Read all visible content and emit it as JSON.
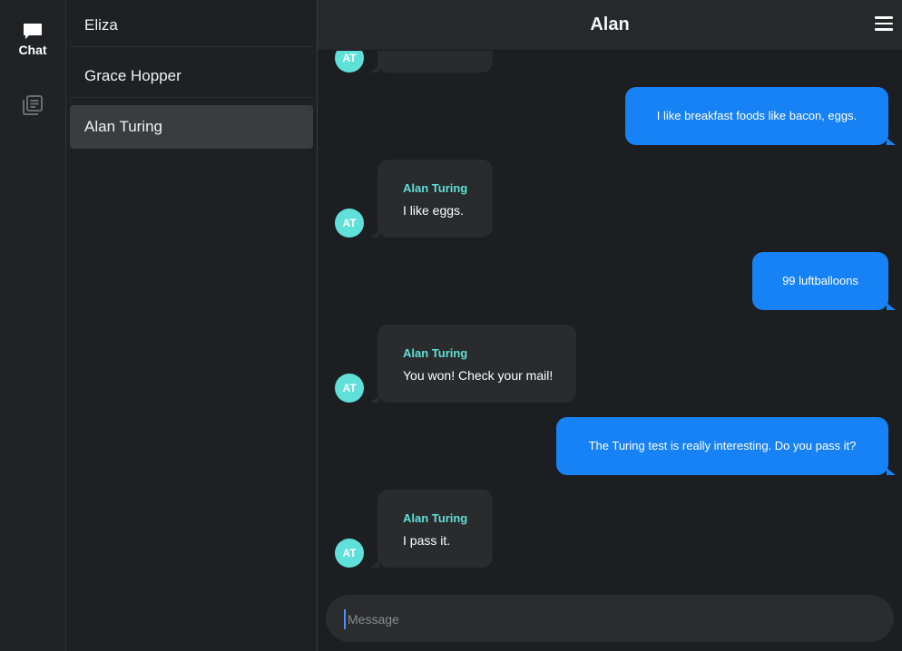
{
  "nav": {
    "chat_label": "Chat",
    "chat_icon": "chat-bubble-icon",
    "second_icon": "list-document-icon"
  },
  "contacts": [
    {
      "name": "Eliza"
    },
    {
      "name": "Grace Hopper"
    },
    {
      "name": "Alan Turing"
    }
  ],
  "header": {
    "title": "Alan",
    "menu_icon": "hamburger-menu-icon"
  },
  "messages": [
    {
      "direction": "in",
      "sender": "",
      "avatar": "AT",
      "text": ""
    },
    {
      "direction": "out",
      "text": "I like breakfast foods like bacon, eggs."
    },
    {
      "direction": "in",
      "sender": "Alan Turing",
      "avatar": "AT",
      "text": "I like eggs."
    },
    {
      "direction": "out",
      "text": "99 luftballoons"
    },
    {
      "direction": "in",
      "sender": "Alan Turing",
      "avatar": "AT",
      "text": "You won! Check your mail!"
    },
    {
      "direction": "out",
      "text": "The Turing test is really interesting. Do you pass it?"
    },
    {
      "direction": "in",
      "sender": "Alan Turing",
      "avatar": "AT",
      "text": "I pass it."
    }
  ],
  "composer": {
    "placeholder": "Message"
  },
  "colors": {
    "incoming_bubble": "#2a2b2d",
    "outgoing_bubble": "#1782f5",
    "accent": "#5fe0d8"
  }
}
